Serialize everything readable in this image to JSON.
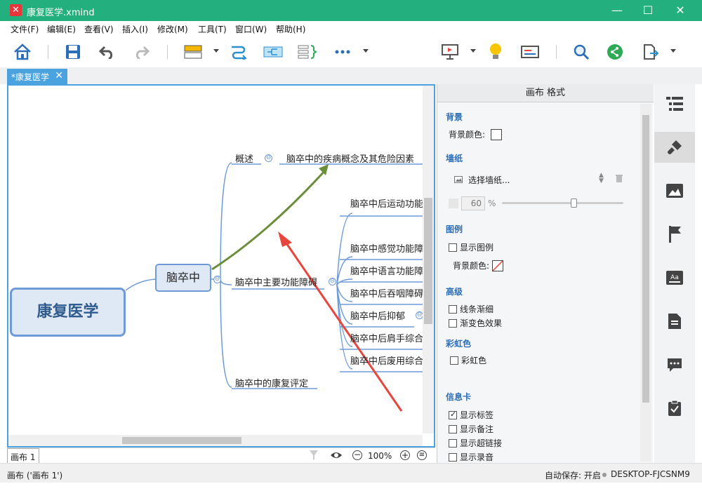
{
  "window": {
    "title": "康复医学.xmind",
    "minimize": "—",
    "maximize": "☐",
    "close": "✕"
  },
  "menu": [
    "文件(F)",
    "编辑(E)",
    "查看(V)",
    "插入(I)",
    "修改(M)",
    "工具(T)",
    "窗口(W)",
    "帮助(H)"
  ],
  "toolbar": {
    "icons": [
      "home-icon",
      "save-icon",
      "undo-icon",
      "redo-icon",
      "topic-icon",
      "relationship-icon",
      "summary-icon",
      "boundary-icon",
      "more-icon",
      "presentation-icon",
      "idea-icon",
      "filter-icon",
      "search-icon",
      "share-icon",
      "export-icon"
    ]
  },
  "tabs": {
    "doc_tab": "*康复医学",
    "close": "✕"
  },
  "mindmap": {
    "central": "康复医学",
    "main": "脑卒中",
    "branches": {
      "overview": "概述",
      "overview_child": "脑卒中的疾病概念及其危险因素",
      "dysfunction": "脑卒中主要功能障碍",
      "assessment": "脑卒中的康复评定"
    },
    "dysfunction_children": [
      "脑卒中后运动功能",
      "脑卒中感觉功能障",
      "脑卒中语言功能障",
      "脑卒中后吞咽障碍",
      "脑卒中后抑郁",
      "脑卒中后肩手综合",
      "脑卒中后废用综合"
    ],
    "collapse_symbol": "⊖"
  },
  "sheetbar": {
    "sheet_tab": "画布 1",
    "zoom": "100%",
    "zoom_out": "−",
    "zoom_in": "+",
    "menu": "≡"
  },
  "panel": {
    "title": "画布 格式",
    "background": {
      "heading": "背景",
      "color_label": "背景颜色:"
    },
    "wallpaper": {
      "heading": "墙纸",
      "select_label": "选择墙纸...",
      "opacity_value": "60",
      "opacity_unit": "%"
    },
    "legend": {
      "heading": "图例",
      "show_label": "显示图例",
      "color_label": "背景颜色:"
    },
    "advanced": {
      "heading": "高级",
      "taper_label": "线条渐细",
      "gradient_label": "渐变色效果"
    },
    "rainbow": {
      "heading": "彩虹色",
      "label": "彩虹色"
    },
    "info_card": {
      "heading": "信息卡",
      "show_labels": "显示标签",
      "show_notes": "显示备注",
      "show_links": "显示超链接",
      "show_audio": "显示录音"
    }
  },
  "status": {
    "left": "画布 ('画布 1')",
    "autosave": "自动保存: 开启",
    "computer": "DESKTOP-FJCSNM9"
  },
  "colors": {
    "titlebar": "#24b07e",
    "accent": "#4aa3df",
    "heading": "#2c6fb8",
    "arrow": "#e8453c",
    "relationship": "#6b8e3a"
  }
}
